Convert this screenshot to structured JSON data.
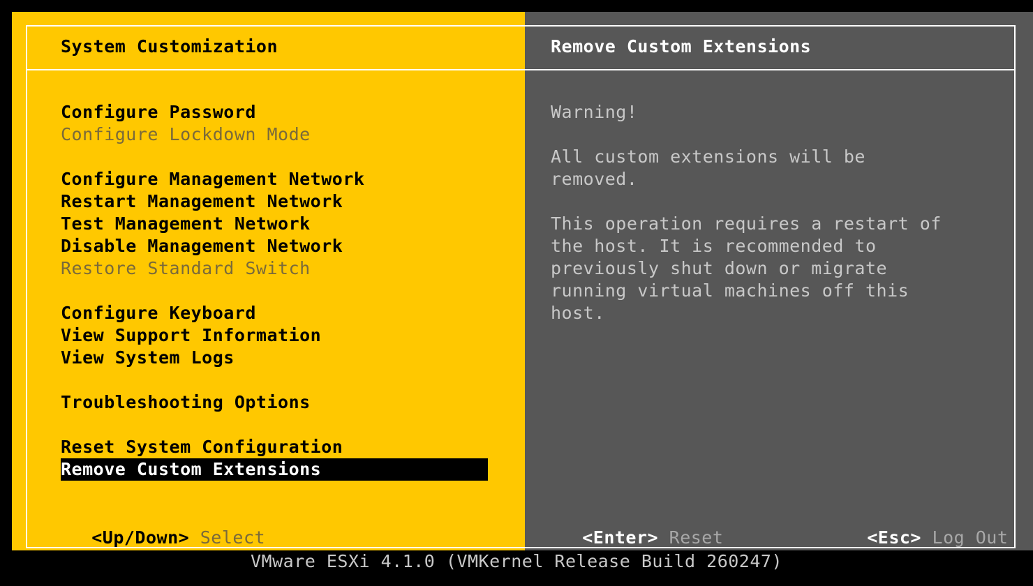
{
  "left_pane": {
    "title": "System Customization",
    "menu_groups": [
      [
        {
          "label": "Configure Password",
          "enabled": true
        },
        {
          "label": "Configure Lockdown Mode",
          "enabled": false
        }
      ],
      [
        {
          "label": "Configure Management Network",
          "enabled": true
        },
        {
          "label": "Restart Management Network",
          "enabled": true
        },
        {
          "label": "Test Management Network",
          "enabled": true
        },
        {
          "label": "Disable Management Network",
          "enabled": true
        },
        {
          "label": "Restore Standard Switch",
          "enabled": false
        }
      ],
      [
        {
          "label": "Configure Keyboard",
          "enabled": true
        },
        {
          "label": "View Support Information",
          "enabled": true
        },
        {
          "label": "View System Logs",
          "enabled": true
        }
      ],
      [
        {
          "label": "Troubleshooting Options",
          "enabled": true
        }
      ],
      [
        {
          "label": "Reset System Configuration",
          "enabled": true
        },
        {
          "label": "Remove Custom Extensions",
          "enabled": true,
          "selected": true
        }
      ]
    ],
    "footer": {
      "key": "<Up/Down>",
      "action": "Select"
    }
  },
  "right_pane": {
    "title": "Remove Custom Extensions",
    "description": [
      "Warning!",
      "",
      "All custom extensions will be",
      "removed.",
      "",
      "This operation requires a restart of",
      "the host. It is recommended to",
      "previously shut down or migrate",
      "running virtual machines off this",
      "host."
    ],
    "footer": {
      "enter_key": "<Enter>",
      "enter_action": "Reset",
      "esc_key": "<Esc>",
      "esc_action": "Log Out"
    }
  },
  "status_bar": {
    "version": "VMware ESXi 4.1.0 (VMKernel Release Build 260247)"
  },
  "colors": {
    "left_background": "#ffc800",
    "right_background": "#575757",
    "frame": "#ffffff",
    "selection_background": "#000000",
    "selection_text": "#ffffff"
  }
}
